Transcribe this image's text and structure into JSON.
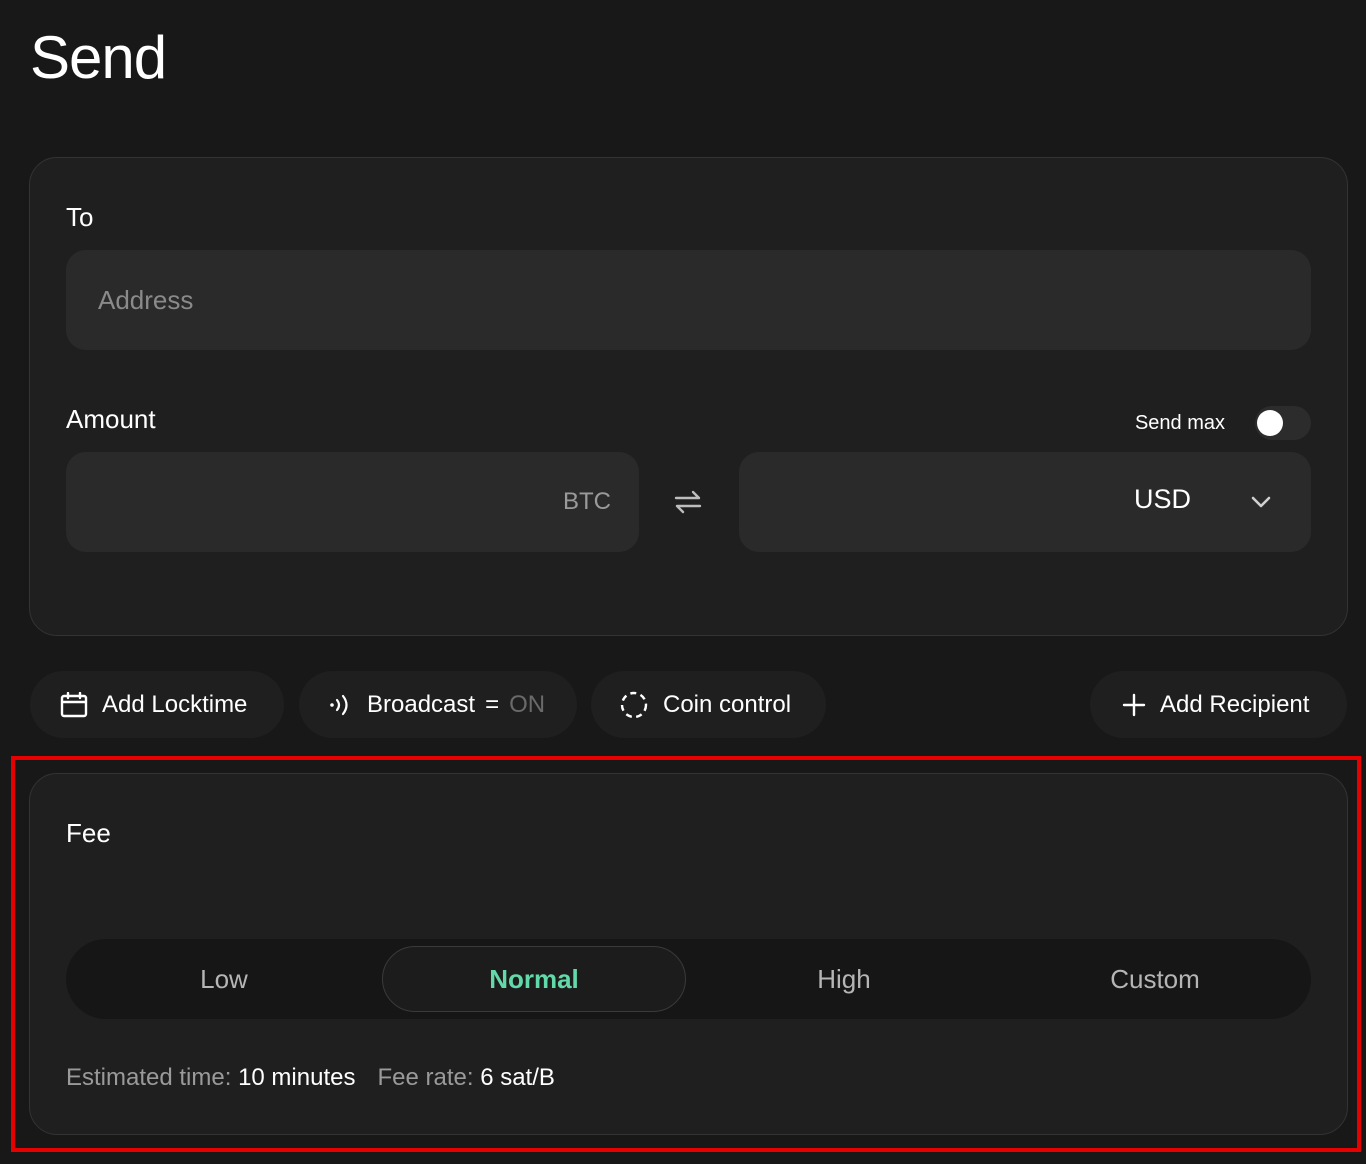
{
  "page": {
    "title": "Send"
  },
  "send_form": {
    "to_label": "To",
    "address_placeholder": "Address",
    "amount_label": "Amount",
    "send_max_label": "Send max",
    "send_max_on": false,
    "btc_unit": "BTC",
    "fiat_currency": "USD"
  },
  "actions": {
    "locktime": "Add Locktime",
    "broadcast_label": "Broadcast",
    "broadcast_eq": "=",
    "broadcast_state": "ON",
    "coin_control": "Coin control",
    "add_recipient": "Add Recipient"
  },
  "fee": {
    "label": "Fee",
    "tabs": [
      "Low",
      "Normal",
      "High",
      "Custom"
    ],
    "selected": "Normal",
    "estimated_time_key": "Estimated time:",
    "estimated_time_value": "10 minutes",
    "fee_rate_key": "Fee rate:",
    "fee_rate_value": "6 sat/B"
  },
  "colors": {
    "background": "#181818",
    "card": "#1f1f1f",
    "input": "#2a2a2a",
    "accent": "#62d9a8",
    "highlight": "#e60000"
  },
  "icons": {
    "locktime": "calendar-icon",
    "broadcast": "broadcast-icon",
    "coin_control": "dashed-circle-icon",
    "add_recipient": "plus-icon",
    "swap": "swap-arrows-icon",
    "currency_dropdown": "chevron-down-icon"
  }
}
